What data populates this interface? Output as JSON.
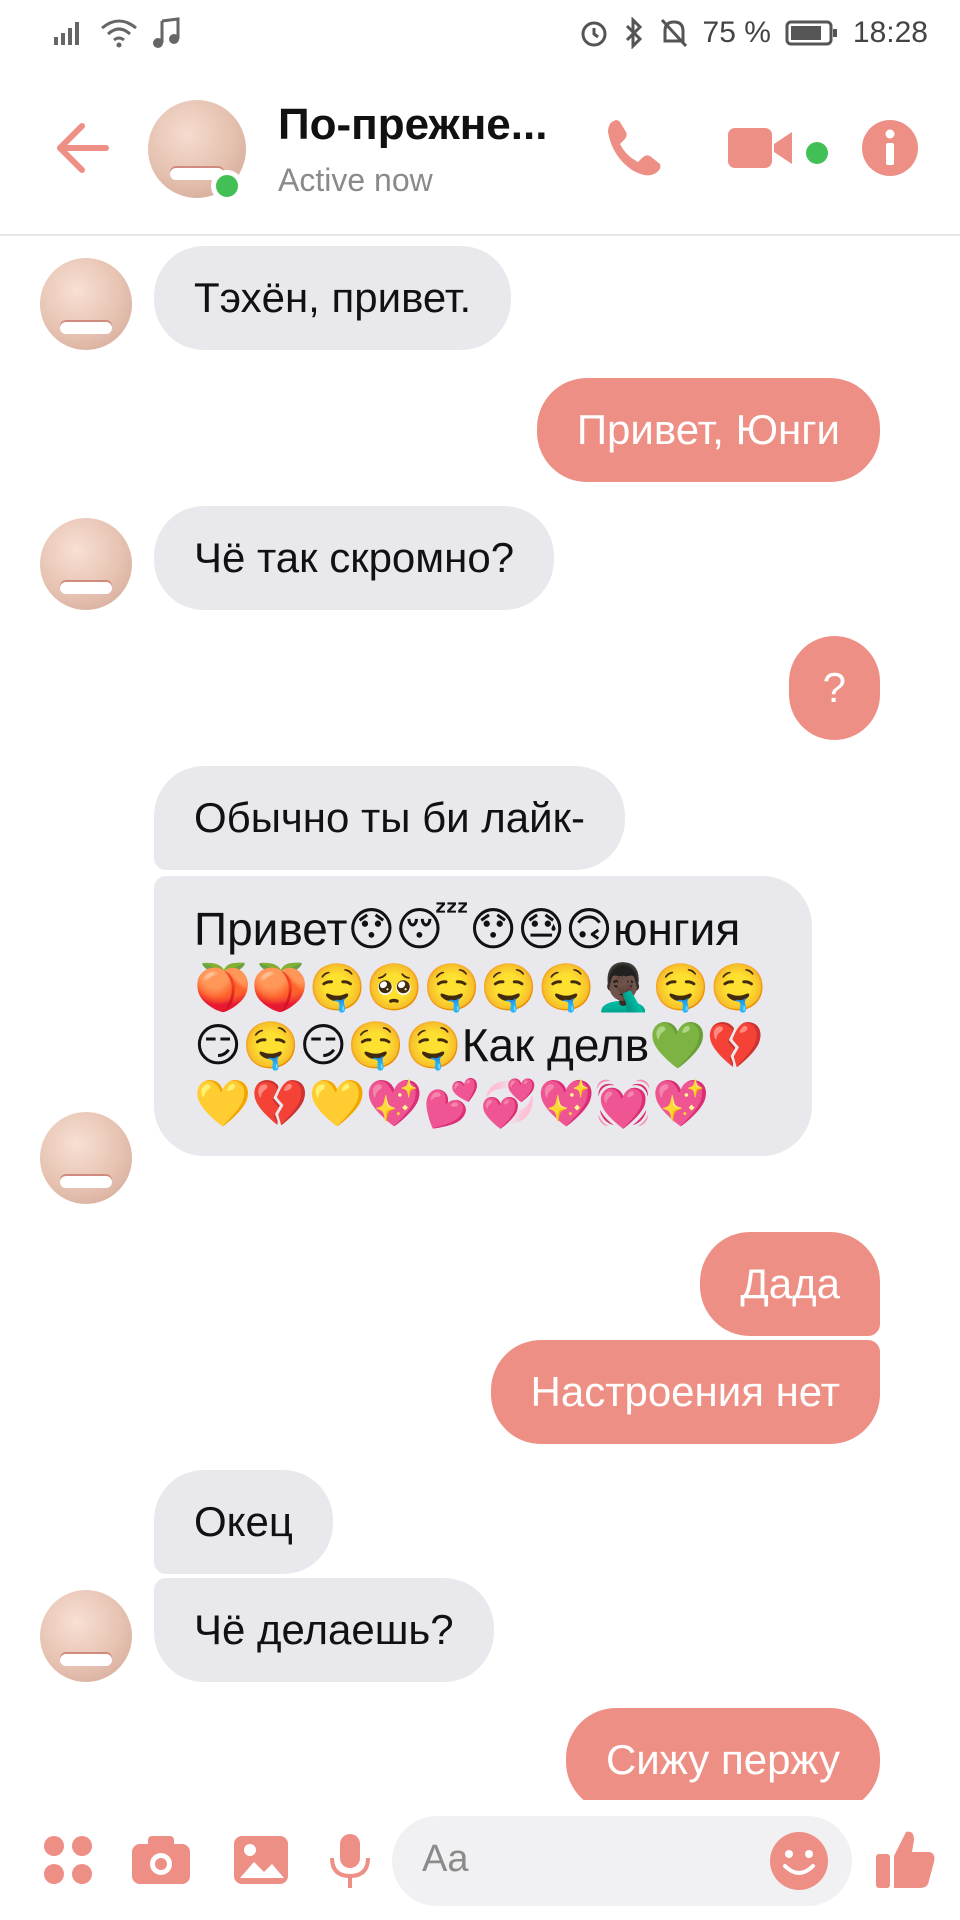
{
  "status_bar": {
    "battery_percent": "75 %",
    "time": "18:28"
  },
  "header": {
    "title": "По-прежне...",
    "subtitle": "Active now",
    "accent_color": "#ee8f85",
    "online_color": "#43c055"
  },
  "messages": [
    {
      "direction": "in",
      "text": "Тэхён, привет."
    },
    {
      "direction": "out",
      "text": "Привет, Юнги"
    },
    {
      "direction": "in",
      "text": "Чё так скромно?"
    },
    {
      "direction": "out",
      "text": "?"
    },
    {
      "direction": "in",
      "text": "Обычно ты би лайк-"
    },
    {
      "direction": "in",
      "text": "Привет😯😴😯😓🙃юнгия🍑🍑🤤🥺🤤🤤🤤🤦🏿‍♂️🤤🤤😏🤤😏🤤🤤Как делв💚💔💛💔💛💖💕💞💖💓💖"
    },
    {
      "direction": "out",
      "text": "Дада"
    },
    {
      "direction": "out",
      "text": "Настроения нет"
    },
    {
      "direction": "in",
      "text": "Окец"
    },
    {
      "direction": "in",
      "text": "Чё делаешь?"
    },
    {
      "direction": "out",
      "text": "Сижу пержу"
    }
  ],
  "composer": {
    "placeholder": "Aa"
  },
  "icons": {
    "status_left": [
      "signal-icon",
      "wifi-icon",
      "music-note-icon"
    ],
    "status_right": [
      "alarm-icon",
      "bluetooth-icon",
      "bell-off-icon",
      "battery-icon"
    ],
    "header": [
      "back-arrow-icon",
      "phone-icon",
      "video-camera-icon",
      "info-icon"
    ],
    "composer": [
      "apps-icon",
      "camera-icon",
      "gallery-icon",
      "microphone-icon",
      "emoji-icon",
      "thumbs-up-icon"
    ]
  }
}
